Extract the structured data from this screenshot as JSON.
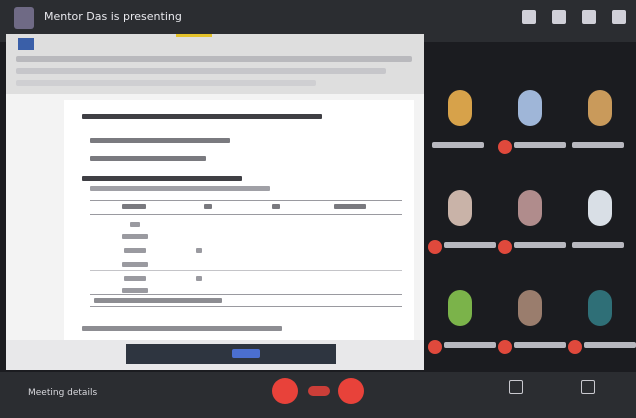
{
  "header": {
    "presenting_text": "Mentor Das is presenting",
    "meeting_time": "",
    "toolbar_icons": [
      "people-icon",
      "chat-icon",
      "raise-hand-icon",
      "more-icon"
    ]
  },
  "document": {
    "section_heading": "",
    "table_rows": 4
  },
  "participants": [
    {
      "name": "",
      "muted": false,
      "avatar_color": "#d7a24a"
    },
    {
      "name": "",
      "muted": true,
      "avatar_color": "#9fb6d8"
    },
    {
      "name": "",
      "muted": false,
      "avatar_color": "#c99a5b"
    },
    {
      "name": "",
      "muted": true,
      "avatar_color": "#c9b3a8"
    },
    {
      "name": "",
      "muted": true,
      "avatar_color": "#b08c8c"
    },
    {
      "name": "",
      "muted": false,
      "avatar_color": "#d9dfe6"
    },
    {
      "name": "",
      "muted": true,
      "avatar_color": "#7bb34a"
    },
    {
      "name": "",
      "muted": true,
      "avatar_color": "#9a7d6d"
    },
    {
      "name": "",
      "muted": true,
      "avatar_color": "#2f6f77"
    }
  ],
  "controls": {
    "meeting_details_label": "Meeting details"
  },
  "colors": {
    "end_call_red": "#e8423a",
    "bar_background": "#2b2d31"
  }
}
